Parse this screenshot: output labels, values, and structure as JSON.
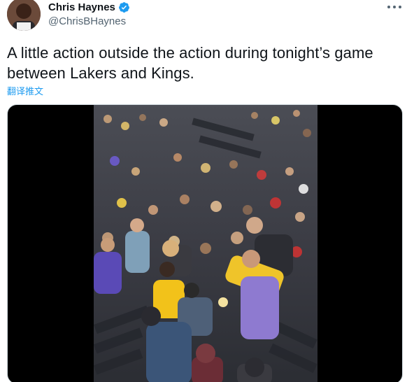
{
  "author": {
    "display_name": "Chris Haynes",
    "handle": "@ChrisBHaynes",
    "verified": true
  },
  "tweet": {
    "text": "A little action outside the action during tonight’s game between Lakers and Kings.",
    "translate_label": "翻译推文"
  },
  "icons": {
    "verified": "verified-badge-icon",
    "more": "more-options-icon"
  },
  "colors": {
    "accent": "#1d9bf0",
    "text": "#0f1419",
    "secondary": "#536471",
    "media_bg": "#000000"
  }
}
